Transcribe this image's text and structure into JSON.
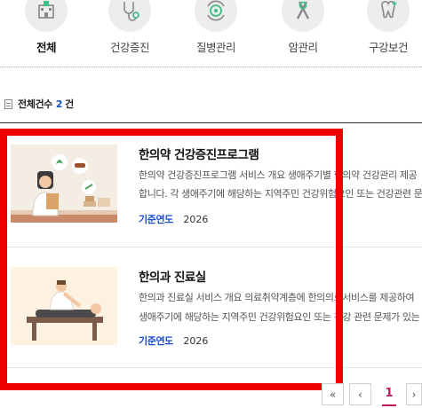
{
  "categories": [
    {
      "label": "전체",
      "icon": "hospital-icon",
      "active": true
    },
    {
      "label": "건강증진",
      "icon": "stethoscope-icon",
      "active": false
    },
    {
      "label": "질병관리",
      "icon": "virus-care-icon",
      "active": false
    },
    {
      "label": "암관리",
      "icon": "ribbon-icon",
      "active": false
    },
    {
      "label": "구강보건",
      "icon": "tooth-icon",
      "active": false
    }
  ],
  "summary": {
    "label": "전체건수",
    "count": "2",
    "unit": "건"
  },
  "programs": [
    {
      "title": "한의약 건강증진프로그램",
      "desc_line1": "한의약 건강증진프로그램 서비스 개요 생애주기별 한의약 건강관리 제공",
      "desc_line2": "합니다. 각 생애주기에 해당하는 지역주민 건강위험요인 또는 건강관련 문제",
      "meta_label": "기준연도",
      "meta_value": "2026",
      "image": "doctor-with-clipboard-illustration"
    },
    {
      "title": "한의과 진료실",
      "desc_line1": "한의과 진료실 서비스 개요 의료취약계층에 한의의료서비스를 제공하여",
      "desc_line2": "생애주기에 해당하는 지역주민 건강위험요인 또는 건강 관련 문제가 있는",
      "meta_label": "기준연도",
      "meta_value": "2026",
      "image": "acupuncture-treatment-illustration"
    }
  ],
  "pagination": {
    "first": "«",
    "prev": "‹",
    "current": "1",
    "next": "›"
  },
  "colors": {
    "accent": "#1a4fcc",
    "highlight": "#ef0000",
    "page_active": "#c2185b"
  }
}
